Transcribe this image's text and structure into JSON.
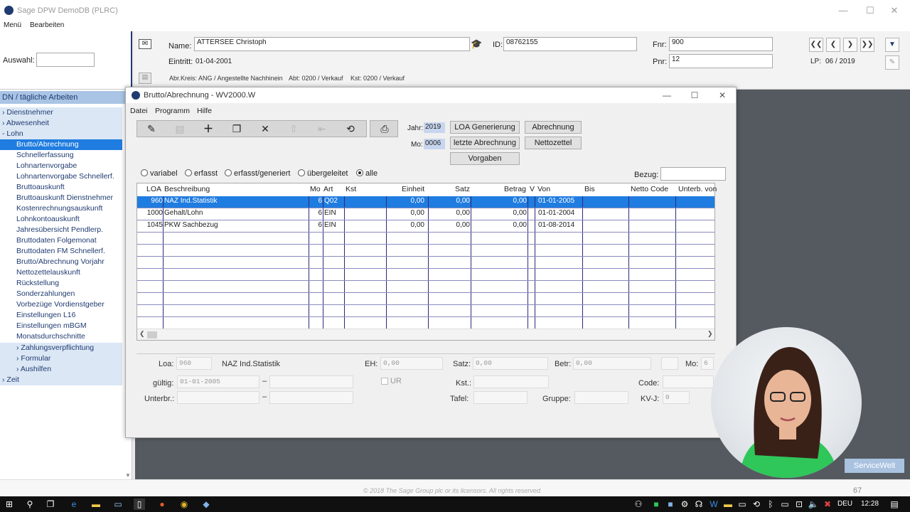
{
  "app": {
    "title": "Sage DPW DemoDB (PLRC)"
  },
  "main_menu": [
    "Menü",
    "Bearbeiten"
  ],
  "header": {
    "auswahl_label": "Auswahl:",
    "auswahl_value": "",
    "name_label": "Name:",
    "name_value": "ATTERSEE Christoph",
    "id_label": "ID:",
    "id_value": "08762155",
    "fnr_label": "Fnr:",
    "fnr_value": "900",
    "pnr_label": "Pnr:",
    "pnr_value": "12",
    "eintritt_label": "Eintritt:",
    "eintritt_value": "01-04-2001",
    "abr_kreis": "Abr.Kreis: ANG / Angestellte Nachhinein",
    "abt": "Abt: 0200 / Verkauf",
    "kst": "Kst: 0200 / Verkauf",
    "lp_label": "LP:",
    "lp_value": "06 / 2019"
  },
  "nav": {
    "header": "DN / tägliche Arbeiten",
    "items": [
      {
        "label": "› Dienstnehmer"
      },
      {
        "label": "› Abwesenheit"
      },
      {
        "label": "- Lohn"
      },
      {
        "label": "Brutto/Abrechnung"
      },
      {
        "label": "Schnellerfassung"
      },
      {
        "label": "Lohnartenvorgabe"
      },
      {
        "label": "Lohnartenvorgabe Schnellerf."
      },
      {
        "label": "Bruttoauskunft"
      },
      {
        "label": "Bruttoauskunft Dienstnehmer"
      },
      {
        "label": "Kostenrechnungsauskunft"
      },
      {
        "label": "Lohnkontoauskunft"
      },
      {
        "label": "Jahresübersicht Pendlerp."
      },
      {
        "label": "Bruttodaten Folgemonat"
      },
      {
        "label": "Bruttodaten FM Schnellerf."
      },
      {
        "label": "Brutto/Abrechnung Vorjahr"
      },
      {
        "label": "Nettozettelauskunft"
      },
      {
        "label": "Rückstellung"
      },
      {
        "label": "Sonderzahlungen"
      },
      {
        "label": "Vorbezüge Vordienstgeber"
      },
      {
        "label": "Einstellungen L16"
      },
      {
        "label": "Einstellungen mBGM"
      },
      {
        "label": "Monatsdurchschnitte"
      },
      {
        "label": "› Zahlungsverpflichtung"
      },
      {
        "label": "› Formular"
      },
      {
        "label": "› Aushilfen"
      },
      {
        "label": "› Zeit"
      }
    ]
  },
  "dialog": {
    "title": "Brutto/Abrechnung - WV2000.W",
    "menu": [
      "Datei",
      "Programm",
      "Hilfe"
    ],
    "jahr_label": "Jahr:",
    "jahr_value": "2019",
    "mo_label": "Mo:",
    "mo_value": "0006",
    "buttons": {
      "loa_generierung": "LOA Generierung",
      "abrechnung": "Abrechnung",
      "letzte_abrechnung": "letzte Abrechnung",
      "nettozettel": "Nettozettel",
      "vorgaben": "Vorgaben"
    },
    "filters": [
      "variabel",
      "erfasst",
      "erfasst/generiert",
      "übergeleitet",
      "alle"
    ],
    "filter_selected": "alle",
    "bezug_label": "Bezug:",
    "columns": [
      "LOA",
      "Beschreibung",
      "Mo",
      "Art",
      "Kst",
      "Einheit",
      "Satz",
      "Betrag",
      "V",
      "Von",
      "Bis",
      "Netto",
      "Code",
      "Unterb. von"
    ],
    "rows": [
      {
        "loa": "960",
        "beschreibung": "NAZ Ind.Statistik",
        "mo": "6",
        "art": "Q02",
        "kst": "",
        "einheit": "0,00",
        "satz": "0,00",
        "betrag": "0,00",
        "von": "01-01-2005"
      },
      {
        "loa": "1000",
        "beschreibung": "Gehalt/Lohn",
        "mo": "6",
        "art": "EIN",
        "kst": "",
        "einheit": "0,00",
        "satz": "0,00",
        "betrag": "0,00",
        "von": "01-01-2004"
      },
      {
        "loa": "1045",
        "beschreibung": "PKW Sachbezug",
        "mo": "6",
        "art": "EIN",
        "kst": "",
        "einheit": "0,00",
        "satz": "0,00",
        "betrag": "0,00",
        "von": "01-08-2014"
      }
    ],
    "detail": {
      "loa_label": "Loa:",
      "loa_value": "960",
      "loa_desc": "NAZ Ind.Statistik",
      "eh_label": "EH:",
      "eh_value": "0,00",
      "satz_label": "Satz:",
      "satz_value": "0,00",
      "betr_label": "Betr:",
      "betr_value": "0,00",
      "mo_label": "Mo:",
      "mo_value": "6",
      "gueltig_label": "gültig:",
      "gueltig_from": "01-01-2005",
      "unterbr_label": "Unterbr.:",
      "ur_label": "UR",
      "kst_label": "Kst.:",
      "tafel_label": "Tafel:",
      "gruppe_label": "Gruppe:",
      "code_label": "Code:",
      "kvj_label": "KV-J:",
      "kvj_value": "0"
    }
  },
  "overlay": {
    "brand": "ServiceWelt"
  },
  "footer": {
    "copyright": "© 2018 The Sage Group plc or its licensors. All rights reserved.",
    "page_number": "67"
  },
  "taskbar": {
    "lang": "DEU",
    "time": "12:28"
  }
}
